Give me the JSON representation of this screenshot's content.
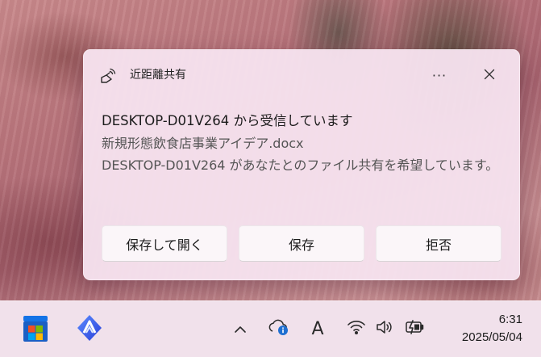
{
  "notification": {
    "app_name": "近距離共有",
    "more_label": "···",
    "title": "DESKTOP-D01V264 から受信しています",
    "file_name": "新規形態飲食店事業アイデア.docx",
    "message": "DESKTOP-D01V264 があなたとのファイル共有を希望しています。",
    "buttons": {
      "save_and_open": "保存して開く",
      "save": "保存",
      "decline": "拒否"
    }
  },
  "taskbar": {
    "ime_indicator": "A",
    "clock_time": "6:31",
    "clock_date": "2025/05/04"
  },
  "icons": {
    "app": "nearby-share-icon",
    "close": "close-icon",
    "start": "windows-start-icon",
    "pinned_app": "app-logo-icon",
    "overflow": "chevron-up-icon",
    "onedrive": "cloud-info-icon",
    "wifi": "wifi-icon",
    "volume": "speaker-icon",
    "battery": "battery-charging-icon"
  },
  "colors": {
    "windows_blue": "#1473e6",
    "windows_red": "#f25022",
    "windows_green": "#7fba00",
    "windows_yellow": "#ffb900",
    "onedrive_badge": "#1f6fd1"
  }
}
